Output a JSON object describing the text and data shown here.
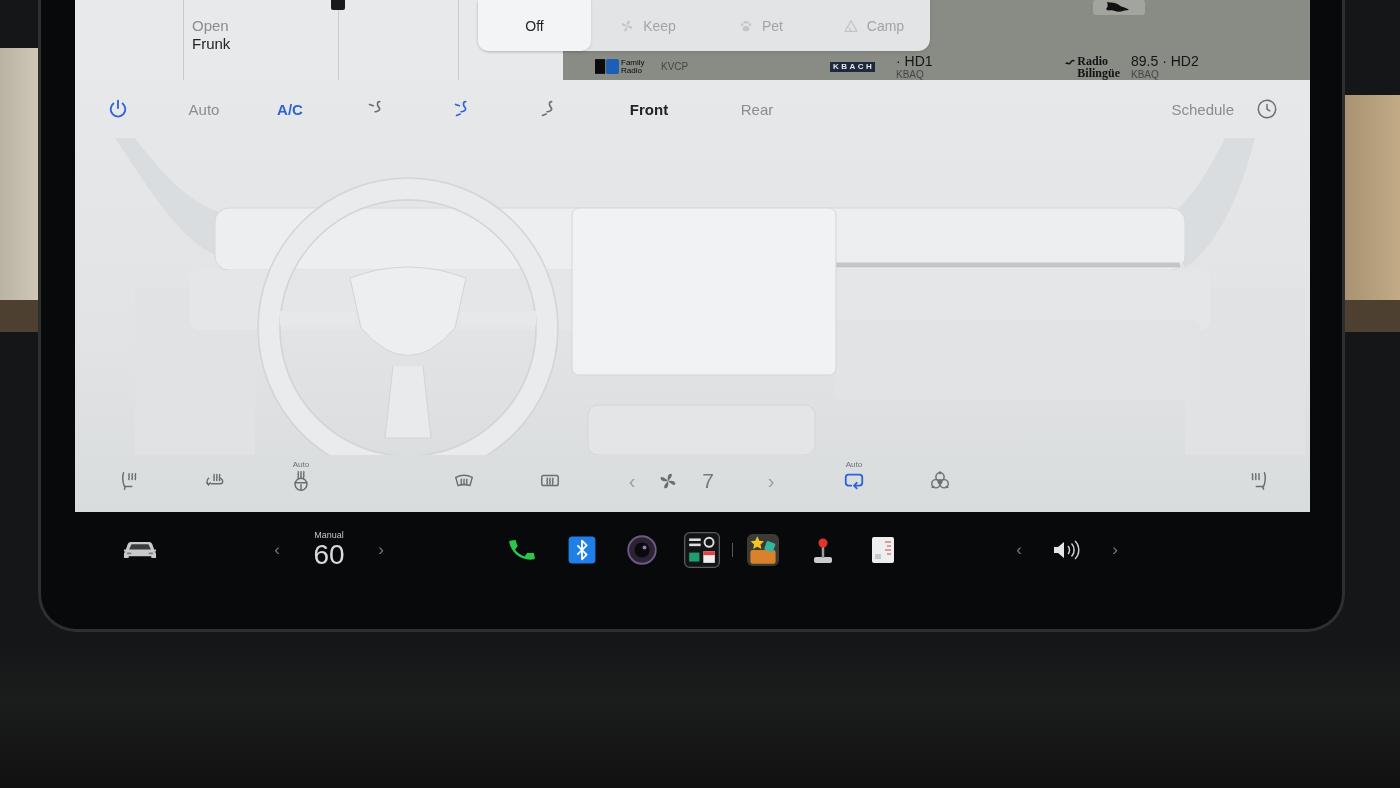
{
  "top_panel": {
    "shortcut": {
      "label": "Open",
      "value": "Frunk"
    }
  },
  "mode_popup": {
    "options": [
      {
        "kind": "off",
        "label": "Off",
        "selected": true
      },
      {
        "kind": "keep",
        "label": "Keep",
        "selected": false
      },
      {
        "kind": "pet",
        "label": "Pet",
        "selected": false
      },
      {
        "kind": "camp",
        "label": "Camp",
        "selected": false
      }
    ]
  },
  "media": {
    "stations": [
      {
        "kind": "family",
        "logo_text": "Family Radio",
        "call_sign": "KVCP"
      },
      {
        "kind": "kbach",
        "logo_text": "KBACH",
        "frequency": "· HD1",
        "call_sign": "KBAQ"
      },
      {
        "kind": "bilingue",
        "logo_text": "Radio Bilingüe",
        "frequency": "89.5 · HD2",
        "call_sign": "KBAQ"
      }
    ]
  },
  "climate": {
    "power": {
      "on": true
    },
    "auto": {
      "label": "Auto",
      "on": false
    },
    "ac": {
      "label": "A/C",
      "on": true
    },
    "airflow": [
      {
        "kind": "face",
        "selected": false
      },
      {
        "kind": "face_feet",
        "selected": true
      },
      {
        "kind": "feet",
        "selected": false
      }
    ],
    "zones": [
      {
        "label": "Front",
        "selected": true
      },
      {
        "label": "Rear",
        "selected": false
      }
    ],
    "schedule": {
      "label": "Schedule"
    }
  },
  "bottom_controls": {
    "left": [
      {
        "kind": "seat_left",
        "on": false
      },
      {
        "kind": "wiper_heat",
        "on": false
      },
      {
        "kind": "wheel_heat",
        "on": false,
        "caption": "Auto"
      },
      {
        "kind": "front_defrost",
        "on": false
      },
      {
        "kind": "rear_defrost",
        "on": false
      }
    ],
    "fan": {
      "prev": "‹",
      "speed": "7",
      "next": "›"
    },
    "right": [
      {
        "kind": "recirculate",
        "on": true,
        "caption": "Auto"
      },
      {
        "kind": "bioweapon",
        "on": false
      },
      {
        "kind": "seat_right",
        "on": false
      }
    ]
  },
  "taskbar": {
    "temperature": {
      "mode": "Manual",
      "prev": "‹",
      "value": "60",
      "next": "›"
    },
    "apps": [
      {
        "kind": "phone"
      },
      {
        "kind": "bluetooth"
      },
      {
        "kind": "camera"
      },
      {
        "kind": "launcher"
      },
      {
        "kind": "toybox"
      },
      {
        "kind": "arcade"
      },
      {
        "kind": "notes"
      }
    ],
    "volume": {
      "prev": "‹",
      "next": "›"
    }
  }
}
